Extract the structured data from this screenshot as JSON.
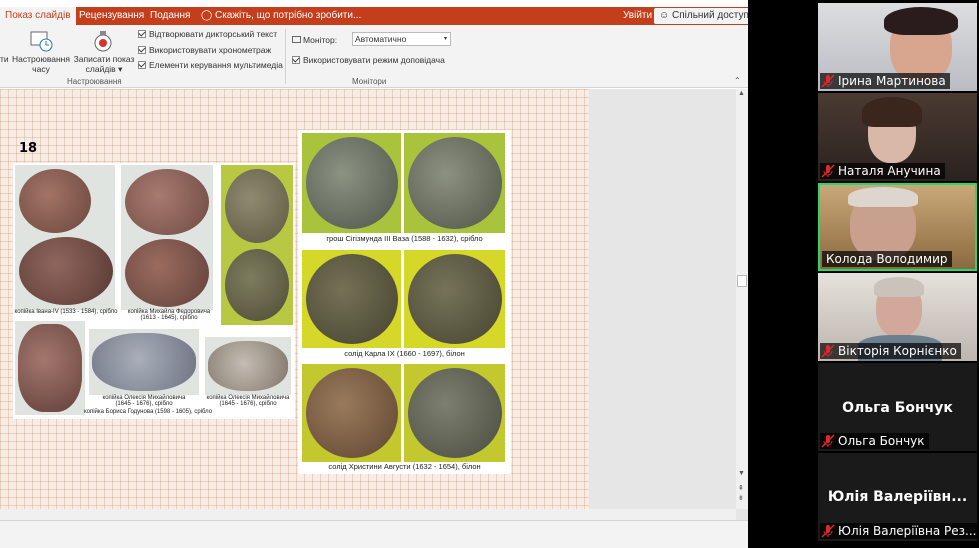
{
  "ribbon": {
    "tabs": [
      {
        "label": "Показ слайдів",
        "active": true
      },
      {
        "label": "Рецензування"
      },
      {
        "label": "Подання"
      }
    ],
    "tell_me": "Скажіть, що потрібно зробити...",
    "sign_in": "Увійти",
    "share": "Спільний доступ",
    "left_cut": "ти",
    "rehearse_l1": "Настроювання",
    "rehearse_l2": "часу",
    "record_l1": "Записати показ",
    "record_l2": "слайдів",
    "checkboxes": [
      "Відтворювати дикторський текст",
      "Використовувати хронометраж",
      "Елементи керування мультимедіа"
    ],
    "group_setup": "Настроювання",
    "monitor_label": "Монітор:",
    "monitor_value": "Автоматично",
    "presenter_view": "Використовувати режим доповідача",
    "group_monitors": "Монітори"
  },
  "slide": {
    "number": "18",
    "captions": {
      "ivan": "копійка Івана-IV (1533 - 1584), срібло",
      "mikhail_1": "копійка Михайла Федоровича",
      "mikhail_2": "(1613 - 1645), срібло",
      "oleksii_a_1": "копійка Олексія Михайловича",
      "oleksii_a_2": "(1645 - 1676), срібло",
      "boris": "копійка Бориса Годунова (1598 - 1605), срібло",
      "oleksii_b_1": "копійка Олексія Михайловича",
      "oleksii_b_2": "(1645 - 1676), срібло",
      "sigismund": "грош Сігізмунда III Ваза (1588 - 1632), срібло",
      "karl": "солід Карла IX (1660 - 1697), білон",
      "christina": "солід Христини Августи (1632 - 1654), білон"
    }
  },
  "participants": [
    {
      "name": "Ірина Мартинова",
      "muted": true
    },
    {
      "name": "Наталя Анучина",
      "muted": true
    },
    {
      "name": "Колода Володимир",
      "muted": false,
      "active": true
    },
    {
      "name": "Вікторія Корнієнко",
      "muted": true
    },
    {
      "name": "Ольга Бончук",
      "muted": true,
      "video": false
    },
    {
      "name": "Юлія Валеріївна Рез...",
      "display_name": "Юлія Валеріївн...",
      "muted": true,
      "video": false
    }
  ],
  "colors": {
    "accent": "#c43e1c",
    "active_speaker": "#23d96b",
    "mic_muted": "#e02828"
  }
}
